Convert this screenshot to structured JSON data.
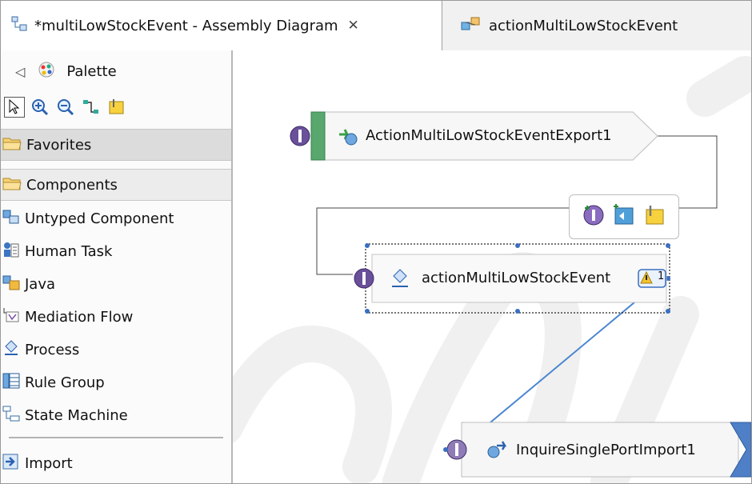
{
  "tabs": [
    {
      "label": "*multiLowStockEvent - Assembly Diagram",
      "icon": "assembly-diagram-icon",
      "active": true
    },
    {
      "label": "actionMultiLowStockEvent",
      "icon": "process-editor-icon",
      "active": false
    }
  ],
  "palette": {
    "title": "Palette",
    "tools": [
      "select-arrow-icon",
      "zoom-in-icon",
      "zoom-out-icon",
      "wire-tool-icon",
      "note-tool-icon"
    ],
    "drawers": {
      "favorites": "Favorites",
      "components": "Components"
    },
    "items": [
      {
        "label": "Untyped Component",
        "icon": "untyped-component-icon"
      },
      {
        "label": "Human Task",
        "icon": "human-task-icon"
      },
      {
        "label": "Java",
        "icon": "java-component-icon"
      },
      {
        "label": "Mediation Flow",
        "icon": "mediation-flow-icon"
      },
      {
        "label": "Process",
        "icon": "process-icon"
      },
      {
        "label": "Rule Group",
        "icon": "rule-group-icon"
      },
      {
        "label": "State Machine",
        "icon": "state-machine-icon"
      }
    ],
    "import_label": "Import"
  },
  "canvas": {
    "export_node": "ActionMultiLowStockEventExport1",
    "component_node": "actionMultiLowStockEvent",
    "import_node": "InquireSinglePortImport1",
    "warning_badge": "1",
    "hover_actions": [
      "add-interface-icon",
      "add-reference-icon",
      "add-note-icon"
    ]
  },
  "colors": {
    "accent_blue": "#2f7fbf",
    "interface_purple": "#6a4f9b",
    "export_green": "#54a66a",
    "wire_blue": "#4a86d0"
  }
}
